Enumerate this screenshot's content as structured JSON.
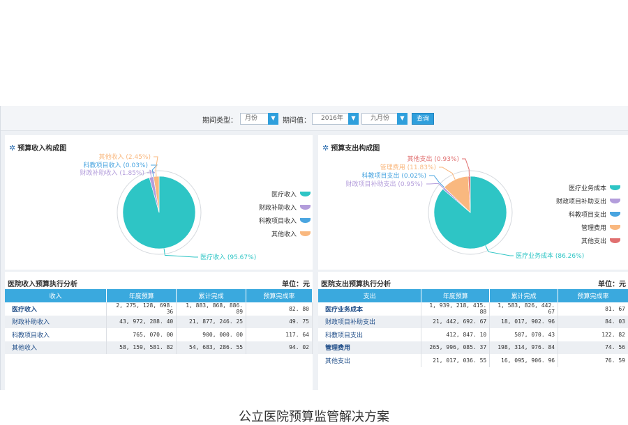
{
  "filters": {
    "period_type_label": "期间类型：",
    "period_type_value": "月份",
    "period_value_label": "期间值：",
    "year_value": "2016年",
    "month_value": "九月份",
    "query_label": "查询"
  },
  "income_panel": {
    "title": "预算收入构成图"
  },
  "expense_panel": {
    "title": "预算支出构成图"
  },
  "colors": {
    "teal": "#2ec5c5",
    "purple": "#b39ddb",
    "blue": "#4aa5e0",
    "orange": "#f9b87f",
    "red": "#e06f6f"
  },
  "chart_data": [
    {
      "type": "pie",
      "title": "预算收入构成图",
      "slices": [
        {
          "name": "医疗收入",
          "value": 95.67,
          "label": "医疗收入 (95.67%)",
          "color": "#2ec5c5"
        },
        {
          "name": "财政补助收入",
          "value": 1.85,
          "label": "财政补助收入 (1.85%)",
          "color": "#b39ddb"
        },
        {
          "name": "科教项目收入",
          "value": 0.03,
          "label": "科教项目收入 (0.03%)",
          "color": "#4aa5e0"
        },
        {
          "name": "其他收入",
          "value": 2.45,
          "label": "其他收入 (2.45%)",
          "color": "#f9b87f"
        }
      ],
      "legend": [
        "医疗收入",
        "财政补助收入",
        "科教项目收入",
        "其他收入"
      ],
      "legend_placement": "right"
    },
    {
      "type": "pie",
      "title": "预算支出构成图",
      "slices": [
        {
          "name": "医疗业务成本",
          "value": 86.26,
          "label": "医疗业务成本 (86.26%)",
          "color": "#2ec5c5"
        },
        {
          "name": "财政项目补助支出",
          "value": 0.95,
          "label": "财政项目补助支出 (0.95%)",
          "color": "#b39ddb"
        },
        {
          "name": "科教项目支出",
          "value": 0.02,
          "label": "科教项目支出 (0.02%)",
          "color": "#4aa5e0"
        },
        {
          "name": "管理费用",
          "value": 11.83,
          "label": "管理费用 (11.83%)",
          "color": "#f9b87f"
        },
        {
          "name": "其他支出",
          "value": 0.93,
          "label": "其他支出 (0.93%)",
          "color": "#e06f6f"
        }
      ],
      "legend": [
        "医疗业务成本",
        "财政项目补助支出",
        "科教项目支出",
        "管理费用",
        "其他支出"
      ],
      "legend_placement": "right"
    }
  ],
  "income_table": {
    "title": "医院收入预算执行分析",
    "unit": "单位：元",
    "headers": [
      "收入",
      "年度预算",
      "累计完成",
      "预算完成率"
    ],
    "rows": [
      [
        "医疗收入",
        "2, 275, 128, 698. 36",
        "1, 883, 868, 886. 89",
        "82. 80"
      ],
      [
        "财政补助收入",
        "43, 972, 288. 40",
        "21, 877, 246. 25",
        "49. 75"
      ],
      [
        "科教项目收入",
        "765, 070. 00",
        "900, 000. 00",
        "117. 64"
      ],
      [
        "其他收入",
        "58, 159, 581. 82",
        "54, 683, 286. 55",
        "94. 02"
      ]
    ]
  },
  "expense_table": {
    "title": "医院支出预算执行分析",
    "unit": "单位：元",
    "headers": [
      "支出",
      "年度预算",
      "累计完成",
      "预算完成率"
    ],
    "rows": [
      [
        "医疗业务成本",
        "1, 939, 218, 415. 88",
        "1, 583, 826, 442. 67",
        "81. 67"
      ],
      [
        "财政项目补助支出",
        "21, 442, 692. 67",
        "18, 017, 902. 96",
        "84. 03"
      ],
      [
        "科教项目支出",
        "412, 847. 10",
        "507, 070. 43",
        "122. 82"
      ],
      [
        "管理费用",
        "265, 996, 085. 37",
        "198, 314, 976. 84",
        "74. 56"
      ],
      [
        "其他支出",
        "21, 017, 036. 55",
        "16, 095, 906. 96",
        "76. 59"
      ]
    ]
  },
  "caption": "公立医院预算监管解决方案"
}
